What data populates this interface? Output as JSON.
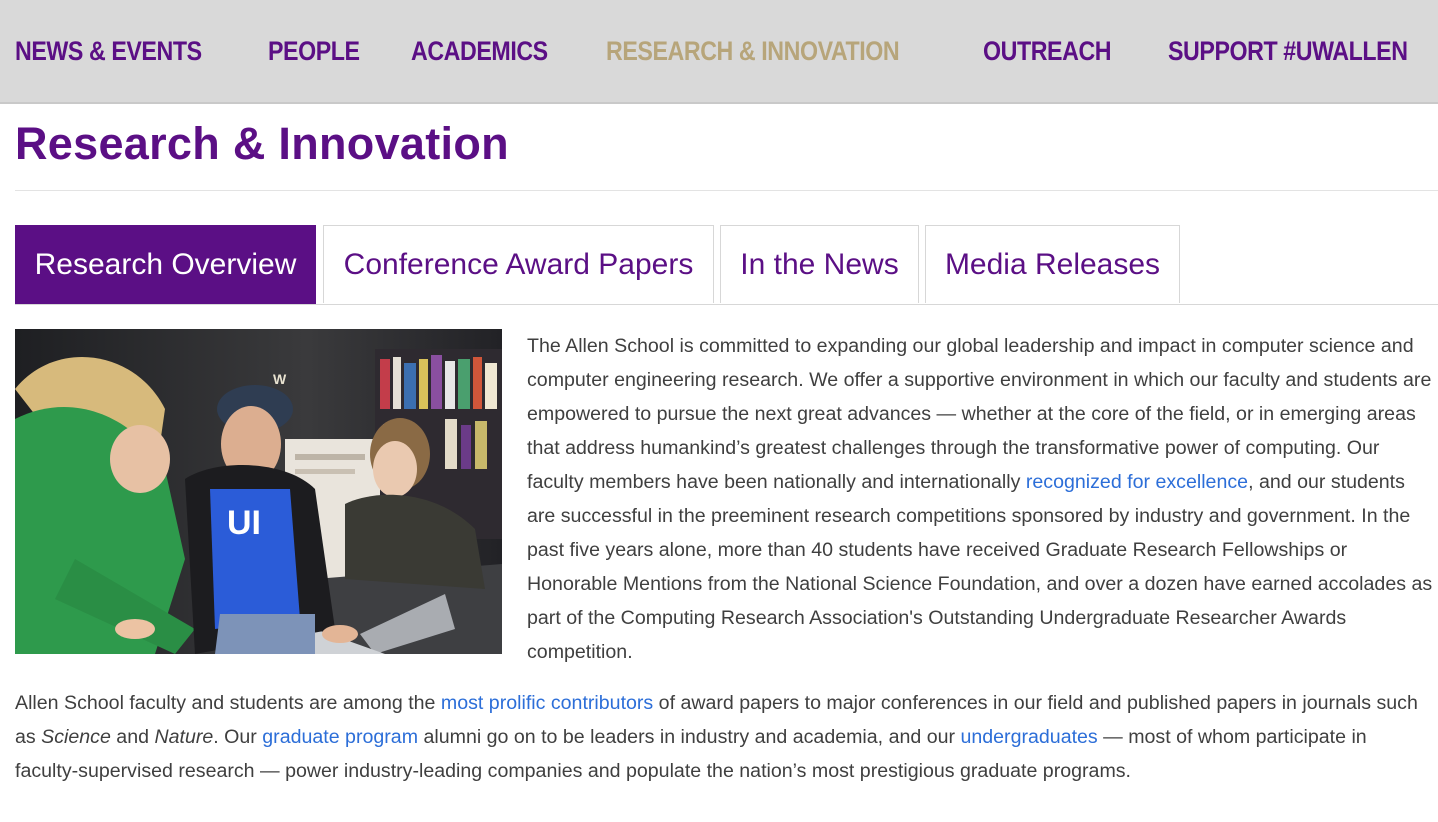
{
  "nav": {
    "items": [
      {
        "label": "NEWS & EVENTS",
        "active": false
      },
      {
        "label": "PEOPLE",
        "active": false
      },
      {
        "label": "ACADEMICS",
        "active": false
      },
      {
        "label": "RESEARCH & INNOVATION",
        "active": true
      },
      {
        "label": "OUTREACH",
        "active": false
      },
      {
        "label": "SUPPORT #UWALLEN",
        "active": false
      }
    ]
  },
  "page": {
    "title": "Research & Innovation"
  },
  "tabs": [
    {
      "label": "Research Overview",
      "active": true
    },
    {
      "label": "Conference Award Papers",
      "active": false
    },
    {
      "label": "In the News",
      "active": false
    },
    {
      "label": "Media Releases",
      "active": false
    }
  ],
  "intro": {
    "text_1": "The Allen School is committed to expanding our global leadership and impact in computer science and computer engineering research. We offer a supportive environment in which our faculty and students are empowered to pursue the next great advances — whether at the core of the field, or in emerging areas that address humankind’s greatest challenges through the transformative power of computing. Our faculty members have been nationally and internationally ",
    "link_1": "recognized for excellence",
    "text_2": ", and our students are successful in the preeminent research competitions sponsored by industry and government. In the past five years alone, more than 40 students have received Graduate Research Fellowships or Honorable Mentions from the National Science Foundation, and over a dozen have earned accolades as part of the Computing Research Association's Outstanding Undergraduate Researcher Awards competition."
  },
  "para2": {
    "t1": "Allen School faculty and students are among the ",
    "link_1": "most prolific contributors",
    "t2": " of award papers to major conferences in our field and published papers in journals such as ",
    "em_1": "Science",
    "t3": " and ",
    "em_2": "Nature",
    "t4": ". Our ",
    "link_2": "graduate program",
    "t5": " alumni go on to be leaders in industry and academia, and our ",
    "link_3": "undergraduates",
    "t6": " — most of whom participate in faculty-supervised research — power industry-leading companies and populate the nation’s most prestigious graduate programs."
  },
  "colors": {
    "purple": "#5b0f85",
    "gold": "#b7a57a",
    "link": "#2c6ed8",
    "nav_bg": "#d9d9d9"
  },
  "photo": {
    "cap_letter": "W",
    "shirt_text": "UI"
  }
}
